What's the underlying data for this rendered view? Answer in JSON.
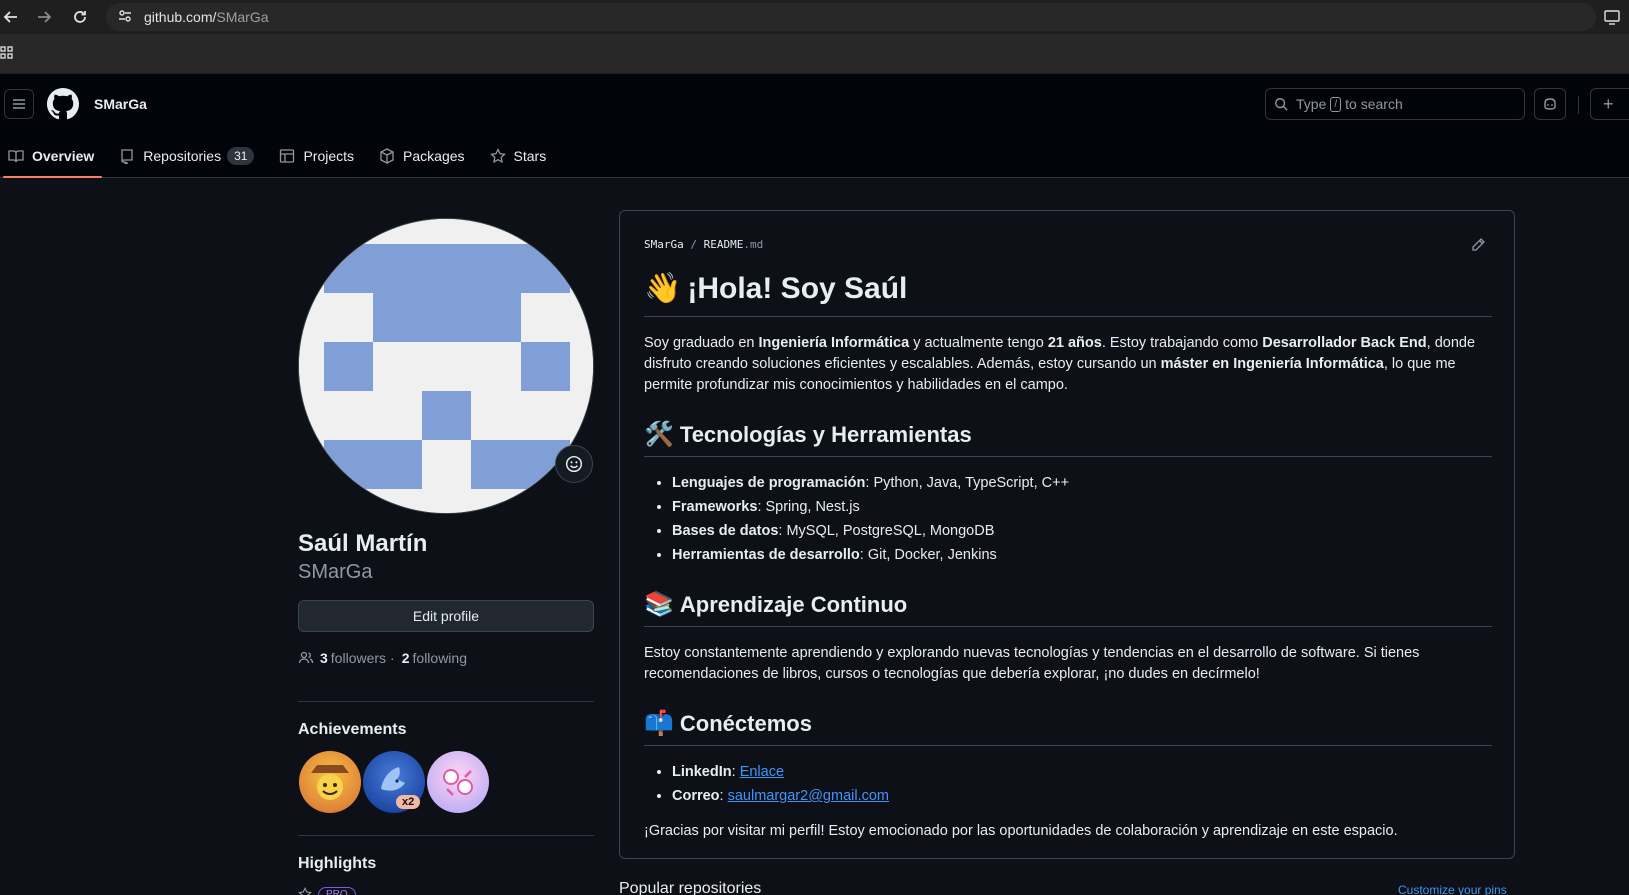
{
  "browser": {
    "url_host": "github.com/",
    "url_path": "SMarGa"
  },
  "header": {
    "username": "SMarGa",
    "search_prefix": "Type",
    "search_key": "/",
    "search_suffix": "to search"
  },
  "tabs": [
    {
      "label": "Overview"
    },
    {
      "label": "Repositories",
      "count": "31"
    },
    {
      "label": "Projects"
    },
    {
      "label": "Packages"
    },
    {
      "label": "Stars"
    }
  ],
  "profile": {
    "full_name": "Saúl Martín",
    "login": "SMarGa",
    "edit_label": "Edit profile",
    "followers_count": "3",
    "followers_label": "followers",
    "separator": "·",
    "following_count": "2",
    "following_label": "following",
    "achievements_title": "Achievements",
    "badge_multiplier": "x2",
    "highlights_title": "Highlights",
    "pro_label": "PRO"
  },
  "readme": {
    "path_user": "SMarGa",
    "path_sep": "/",
    "path_file": "README",
    "path_ext": ".md",
    "h1_emoji": "👋",
    "h1": "¡Hola! Soy Saúl",
    "intro": {
      "t1": "Soy graduado en ",
      "b1": "Ingeniería Informática",
      "t2": " y actualmente tengo ",
      "b2": "21 años",
      "t3": ". Estoy trabajando como ",
      "b3": "Desarrollador Back End",
      "t4": ", donde disfruto creando soluciones eficientes y escalables. Además, estoy cursando un ",
      "b4": "máster en Ingeniería Informática",
      "t5": ", lo que me permite profundizar mis conocimientos y habilidades en el campo."
    },
    "h2_tech_emoji": "🛠️",
    "h2_tech": "Tecnologías y Herramientas",
    "tech_items": [
      {
        "key": "Lenguajes de programación",
        "value": ": Python, Java, TypeScript, C++"
      },
      {
        "key": "Frameworks",
        "value": ": Spring, Nest.js"
      },
      {
        "key": "Bases de datos",
        "value": ": MySQL, PostgreSQL, MongoDB"
      },
      {
        "key": "Herramientas de desarrollo",
        "value": ": Git, Docker, Jenkins"
      }
    ],
    "h2_learn_emoji": "📚",
    "h2_learn": "Aprendizaje Continuo",
    "learn_text": "Estoy constantemente aprendiendo y explorando nuevas tecnologías y tendencias en el desarrollo de software. Si tienes recomendaciones de libros, cursos o tecnologías que debería explorar, ¡no dudes en decírmelo!",
    "h2_connect_emoji": "📫",
    "h2_connect": "Conéctemos",
    "connect_items": [
      {
        "key": "LinkedIn",
        "sep": ": ",
        "link": "Enlace"
      },
      {
        "key": "Correo",
        "sep": ": ",
        "link": "saulmargar2@gmail.com"
      }
    ],
    "closing": "¡Gracias por visitar mi perfil! Estoy emocionado por las oportunidades de colaboración y aprendizaje en este espacio."
  },
  "popular": {
    "title": "Popular repositories",
    "customize": "Customize your pins"
  },
  "colors": {
    "avatar_fill": "#7f9fd6",
    "accent": "#f78166",
    "link": "#4493f8"
  }
}
